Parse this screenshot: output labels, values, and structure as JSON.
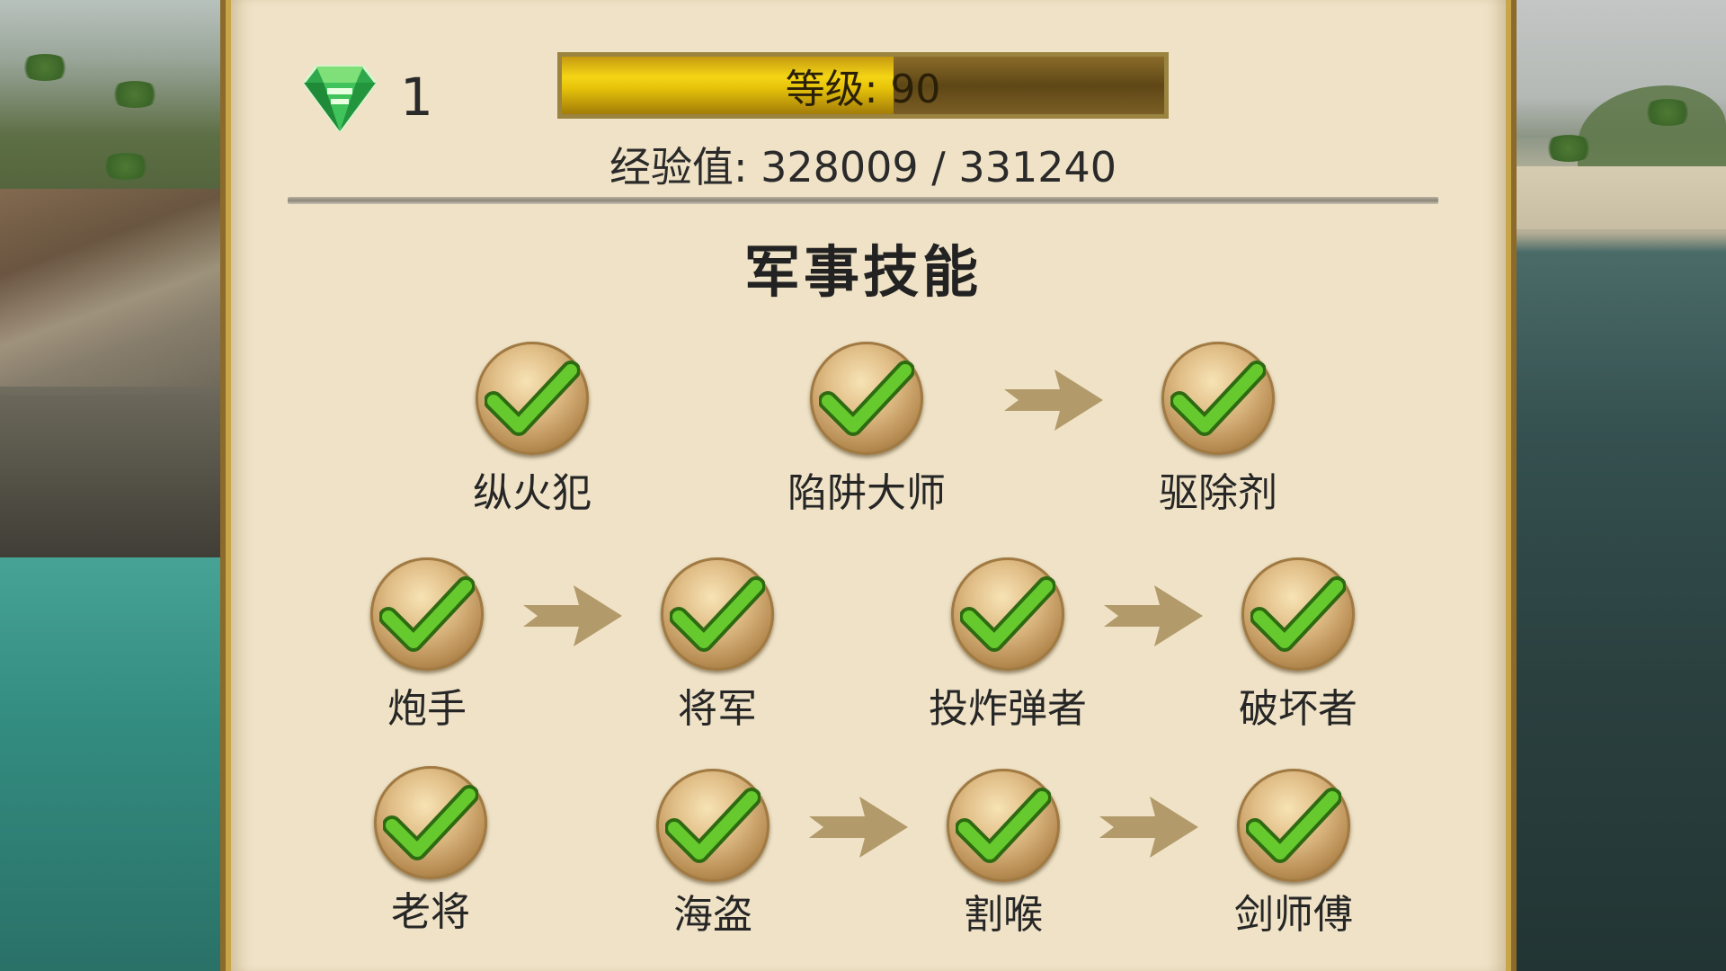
{
  "hud": {
    "gem_count": "1",
    "level_text": "等级: 90",
    "level_fill_fraction": 0.55,
    "xp_text": "经验值: 328009 / 331240"
  },
  "section_title": "军事技能",
  "skills": {
    "arsonist": {
      "label": "纵火犯",
      "unlocked": true
    },
    "trap_master": {
      "label": "陷阱大师",
      "unlocked": true
    },
    "repellent": {
      "label": "驱除剂",
      "unlocked": true
    },
    "gunner": {
      "label": "炮手",
      "unlocked": true
    },
    "general": {
      "label": "将军",
      "unlocked": true
    },
    "bomber": {
      "label": "投炸弹者",
      "unlocked": true
    },
    "destroyer": {
      "label": "破坏者",
      "unlocked": true
    },
    "veteran": {
      "label": "老将",
      "unlocked": true
    },
    "pirate": {
      "label": "海盗",
      "unlocked": true
    },
    "cutthroat": {
      "label": "割喉",
      "unlocked": true
    },
    "swordmaster": {
      "label": "剑师傅",
      "unlocked": true
    }
  },
  "colors": {
    "parchment": "#efe2c6",
    "check_green": "#5cc12a",
    "arrow": "#b29a6a",
    "level_fill": "#f4d515"
  }
}
